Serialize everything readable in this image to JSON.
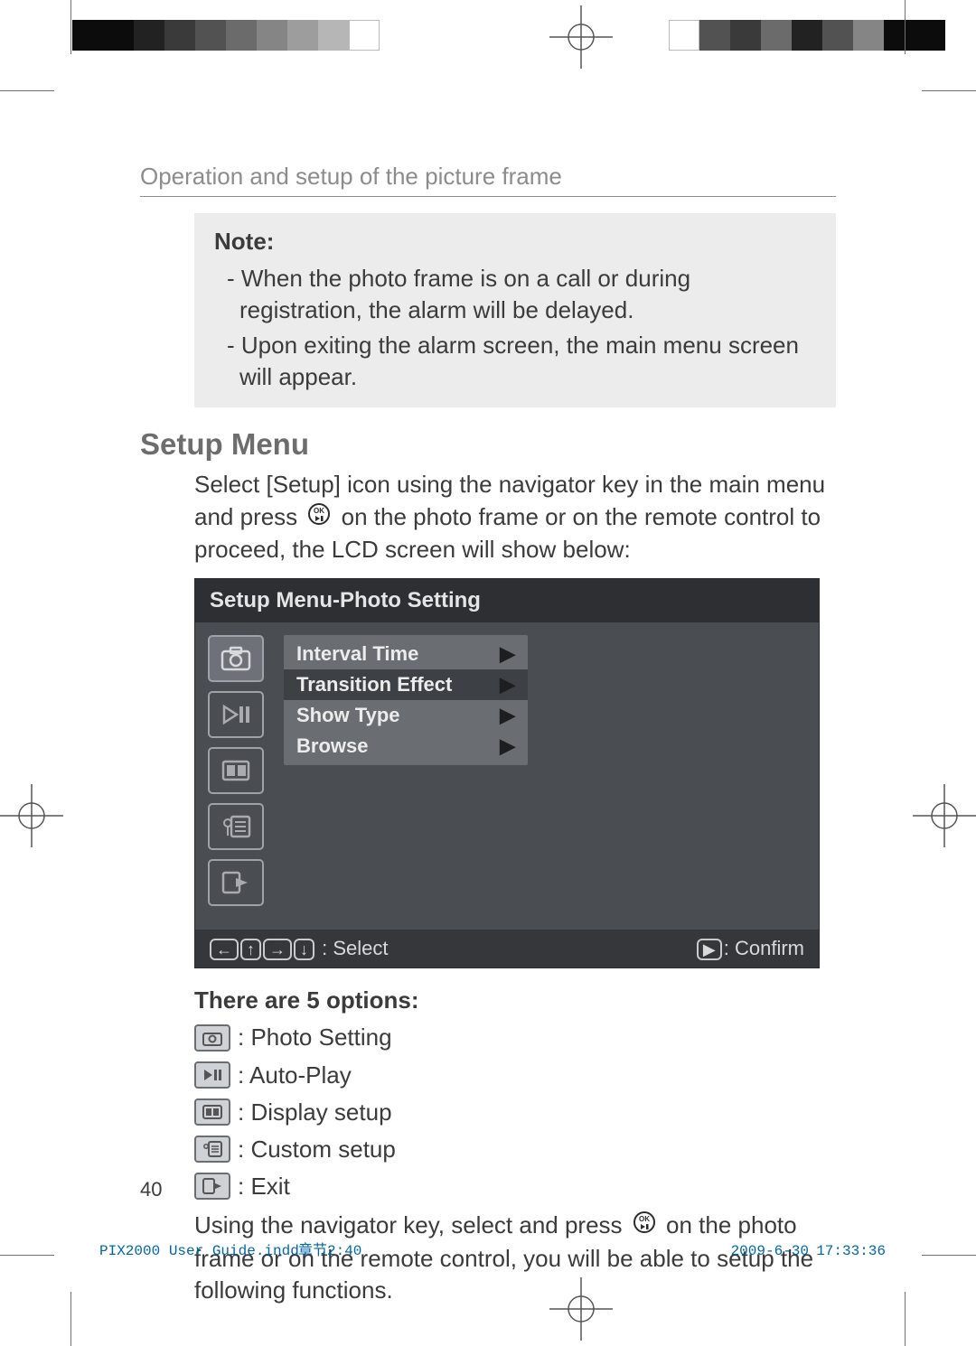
{
  "running_head": "Operation and setup of the picture frame",
  "note": {
    "title": "Note:",
    "items": [
      "- When the photo frame is on a call or during registration, the alarm will be delayed.",
      "- Upon exiting the alarm screen, the main menu screen will appear."
    ]
  },
  "section_title": "Setup Menu",
  "intro_before_icon": "Select [Setup] icon using the navigator key in the main menu and press ",
  "intro_after_icon": " on the photo frame or on the remote control to proceed, the LCD screen will show below:",
  "lcd": {
    "title": "Setup Menu-Photo Setting",
    "side_icons": [
      "photo-setting-icon",
      "auto-play-icon",
      "display-setup-icon",
      "custom-setup-icon",
      "exit-icon"
    ],
    "submenu": [
      {
        "label": "Interval Time",
        "selected": false
      },
      {
        "label": "Transition Effect",
        "selected": true
      },
      {
        "label": "Show Type",
        "selected": false
      },
      {
        "label": "Browse",
        "selected": false
      }
    ],
    "hint_left": " : Select",
    "hint_right": ": Confirm"
  },
  "options_title": "There are 5 options:",
  "options": [
    {
      "icon": "photo-setting-icon",
      "label": " : Photo Setting"
    },
    {
      "icon": "auto-play-icon",
      "label": " : Auto-Play"
    },
    {
      "icon": "display-setup-icon",
      "label": " : Display setup"
    },
    {
      "icon": "custom-setup-icon",
      "label": " : Custom setup"
    },
    {
      "icon": "exit-icon",
      "label": " : Exit"
    }
  ],
  "closing_before_icon": "Using the navigator key, select and press ",
  "closing_after_icon": " on the photo frame or on the remote control, you will be able to setup the following functions.",
  "page_number": "40",
  "slug_file": "PIX2000 User Guide.indd",
  "slug_section": "章节2:40",
  "slug_date": "2009-6-30",
  "slug_time": "17:33:36"
}
